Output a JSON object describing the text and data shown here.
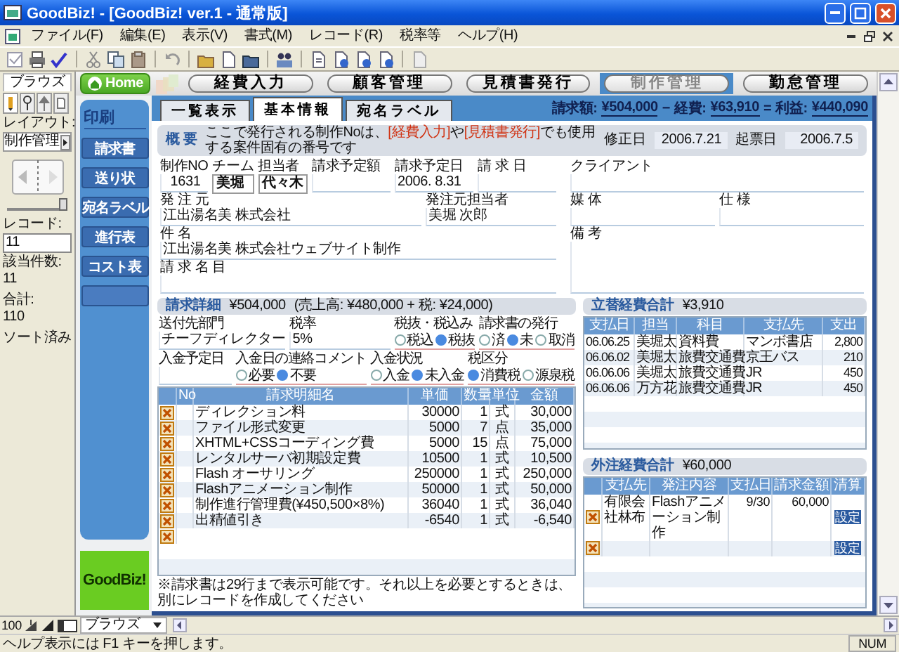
{
  "window": {
    "title": "GoodBiz! - [GoodBiz! ver.1 - 通常版]"
  },
  "menu": [
    "ファイル(F)",
    "編集(E)",
    "表示(V)",
    "書式(M)",
    "レコード(R)",
    "税率等",
    "ヘルプ(H)"
  ],
  "browse_panel": {
    "mode": "ブラウズ",
    "layout_label": "レイアウト:",
    "layout": "制作管理",
    "slider": {
      "level": 1
    },
    "record_label": "レコード:",
    "record": "11",
    "found_label": "該当件数:",
    "found": "11",
    "total_label": "合計:",
    "total": "110",
    "sort": "ソート済み"
  },
  "nav": {
    "home": "Home",
    "tabs": [
      {
        "label": "経費入力",
        "selected": false
      },
      {
        "label": "顧客管理",
        "selected": false
      },
      {
        "label": "見積書発行",
        "selected": false
      },
      {
        "label": "制作管理",
        "selected": true
      },
      {
        "label": "勤怠管理",
        "selected": false
      }
    ]
  },
  "print_panel": {
    "title": "印刷",
    "buttons": [
      "請求書",
      "送り状",
      "宛名ラベル",
      "進行表",
      "コスト表"
    ]
  },
  "logo": "GoodBiz!",
  "view_tabs": [
    {
      "label": "一覧表示",
      "selected": false
    },
    {
      "label": "基本情報",
      "selected": true
    },
    {
      "label": "宛名ラベル",
      "selected": false
    }
  ],
  "summary": {
    "items": [
      {
        "label": "請求額:",
        "value": "¥504,000"
      },
      {
        "label": "経費:",
        "value": "¥63,910"
      },
      {
        "label": "利益:",
        "value": "¥440,090"
      }
    ],
    "operators": [
      "−",
      "="
    ]
  },
  "overview": {
    "title": "概 要",
    "note": [
      {
        "kind": "plain",
        "text": "ここで発行される制作Noは、"
      },
      {
        "kind": "link",
        "text": "[経費入力]"
      },
      {
        "kind": "plain",
        "text": "や"
      },
      {
        "kind": "link",
        "text": "[見積書発行]"
      },
      {
        "kind": "plain",
        "text": "でも使用する案件固有の番号です"
      }
    ],
    "dates": [
      {
        "label": "修正日",
        "value": "2006.7.21"
      },
      {
        "label": "起票日",
        "value": "2006.7.5"
      }
    ],
    "left": [
      [
        {
          "label": "制作NO",
          "value": "1631",
          "kind": "number"
        },
        {
          "label": "チーム",
          "value": "美堀",
          "kind": "tag"
        },
        {
          "label": "担当者",
          "value": "代々木",
          "kind": "tag"
        },
        {
          "label": "請求予定額",
          "kind": "text"
        },
        {
          "label": "請求予定日",
          "value": "2006. 8.31",
          "kind": "text"
        },
        {
          "label": "請 求 日",
          "kind": "text"
        }
      ],
      [
        {
          "label": "発 注 元",
          "value": "江出湯名美 株式会社",
          "kind": "wide"
        },
        {
          "label": "発注元担当者",
          "value": "美堀 次郎",
          "kind": "text"
        }
      ],
      [
        {
          "label": "件 名",
          "value": "江出湯名美 株式会社ウェブサイト制作",
          "kind": "wide"
        }
      ],
      [
        {
          "label": "請 求 名 目",
          "kind": "wide"
        }
      ]
    ],
    "right": [
      [
        {
          "label": "クライアント",
          "kind": "text"
        }
      ],
      [
        {
          "label": "媒 体",
          "kind": "text"
        },
        {
          "label": "仕 様",
          "kind": "text"
        }
      ],
      [
        {
          "label": "備 考",
          "kind": "memo"
        }
      ]
    ]
  },
  "billing": {
    "title": "請求詳細",
    "total": "¥504,000",
    "breakdown": "(売上高: ¥480,000 + 税: ¥24,000)",
    "field_rows": [
      [
        {
          "kind": "text",
          "label": "送付先部門",
          "value": "チーフディレクター"
        },
        {
          "kind": "text",
          "label": "税率",
          "value": "5%"
        },
        {
          "kind": "radio",
          "label": "税抜・税込み",
          "options": [
            {
              "label": "税込",
              "selected": false
            },
            {
              "label": "税抜",
              "selected": true
            }
          ]
        },
        {
          "kind": "radio",
          "label": "請求書の発行",
          "options": [
            {
              "label": "済",
              "selected": false
            },
            {
              "label": "未",
              "selected": true
            },
            {
              "label": "取消",
              "selected": false
            }
          ]
        }
      ],
      [
        {
          "kind": "text",
          "label": "入金予定日"
        },
        {
          "kind": "radio",
          "label": "入金日の連絡コメント",
          "options": [
            {
              "label": "必要",
              "selected": false
            },
            {
              "label": "不要",
              "selected": true
            }
          ]
        },
        {
          "kind": "radio",
          "label": "入金状況",
          "options": [
            {
              "label": "入金",
              "selected": false
            },
            {
              "label": "未入金",
              "selected": true
            }
          ]
        },
        {
          "kind": "radio",
          "label": "税区分",
          "options": [
            {
              "label": "消費税",
              "selected": true
            },
            {
              "label": "源泉税",
              "selected": false
            }
          ]
        }
      ]
    ],
    "columns": [
      "No",
      "請求明細名",
      "単価",
      "数量",
      "単位",
      "金額"
    ],
    "rows": [
      {
        "name": "ディレクション料",
        "unit_price": "30000",
        "qty": "1",
        "unit": "式",
        "amount": "30,000"
      },
      {
        "name": "ファイル形式変更",
        "unit_price": "5000",
        "qty": "7",
        "unit": "点",
        "amount": "35,000"
      },
      {
        "name": "XHTML+CSSコーディング費",
        "unit_price": "5000",
        "qty": "15",
        "unit": "点",
        "amount": "75,000"
      },
      {
        "name": "レンタルサーバ初期設定費",
        "unit_price": "10500",
        "qty": "1",
        "unit": "式",
        "amount": "10,500"
      },
      {
        "name": "Flash オーサリング",
        "unit_price": "250000",
        "qty": "1",
        "unit": "式",
        "amount": "250,000"
      },
      {
        "name": "Flashアニメーション制作",
        "unit_price": "50000",
        "qty": "1",
        "unit": "式",
        "amount": "50,000"
      },
      {
        "name": "制作進行管理費(¥450,500×8%)",
        "unit_price": "36040",
        "qty": "1",
        "unit": "式",
        "amount": "36,040"
      },
      {
        "name": "出精値引き",
        "unit_price": "-6540",
        "qty": "1",
        "unit": "式",
        "amount": "-6,540"
      }
    ],
    "footnote": "※請求書は29行まで表示可能です。それ以上を必要とするときは、別にレコードを作成してください"
  },
  "advances": {
    "title": "立替経費合計",
    "total": "¥3,910",
    "columns": [
      "支払日",
      "担当",
      "科目",
      "支払先",
      "支出"
    ],
    "rows": [
      {
        "date": "06.06.25",
        "staff": "美堀太",
        "item": "資料費",
        "payee": "マンボ書店",
        "amount": "2,800"
      },
      {
        "date": "06.06.02",
        "staff": "美堀太",
        "item": "旅費交通費",
        "payee": "京王バス",
        "amount": "210"
      },
      {
        "date": "06.06.06",
        "staff": "美堀太",
        "item": "旅費交通費",
        "payee": "JR",
        "amount": "450"
      },
      {
        "date": "06.06.06",
        "staff": "万方花",
        "item": "旅費交通費",
        "payee": "JR",
        "amount": "450"
      }
    ]
  },
  "outsourcing": {
    "title": "外注経費合計",
    "total": "¥60,000",
    "columns": [
      "支払先",
      "発注内容",
      "支払日",
      "請求金額",
      "清算"
    ],
    "rows": [
      {
        "payee": "有限会社林布",
        "content": "Flashアニメーション制作",
        "date": "9/30",
        "amount": "60,000",
        "action": "設定"
      },
      {
        "action": "設定"
      }
    ]
  },
  "bottom_bar": {
    "zoom": "100",
    "mode": "ブラウズ"
  },
  "status_bar": {
    "help": "ヘルプ表示には F1 キーを押します。",
    "indicator": "NUM"
  }
}
